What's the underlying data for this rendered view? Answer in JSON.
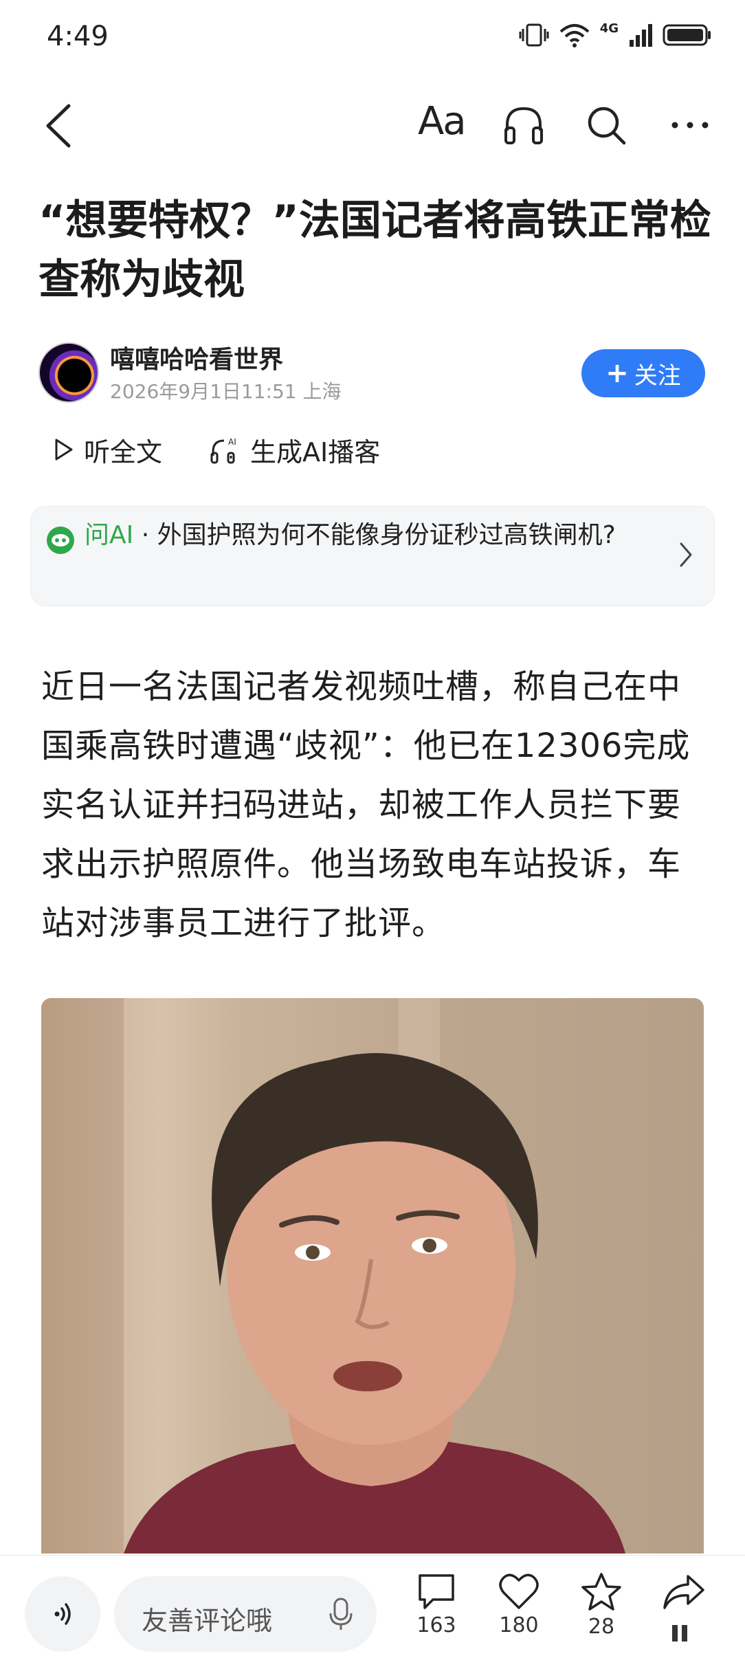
{
  "status_bar": {
    "time": "4:49",
    "network": "4G",
    "signal_label": "6"
  },
  "nav": {
    "font_label": "Aa"
  },
  "article": {
    "title": "“想要特权？”法国记者将高铁正常检查称为歧视",
    "author": "嘻嘻哈哈看世界",
    "meta": "2026年9月1日11:51 上海",
    "follow_label": "关注",
    "listen_label": "听全文",
    "podcast_label": "生成AI播客",
    "ask_ai": {
      "label": "问AI",
      "separator": " · ",
      "question": "外国护照为何不能像身份证秒过高铁闸机?"
    },
    "body": "近日一名法国记者发视频吐槽，称自己在中国乘高铁时遭遇“歧视”：他已在12306完成实名认证并扫码进站，却被工作人员拦下要求出示护照原件。他当场致电车站投诉，车站对涉事员工进行了批评。"
  },
  "bottom_bar": {
    "comment_placeholder": "友善评论哦",
    "comments_count": "163",
    "likes_count": "180",
    "favorites_count": "28"
  },
  "colors": {
    "accent": "#2f7cf6",
    "ai_green": "#2ea84a"
  }
}
